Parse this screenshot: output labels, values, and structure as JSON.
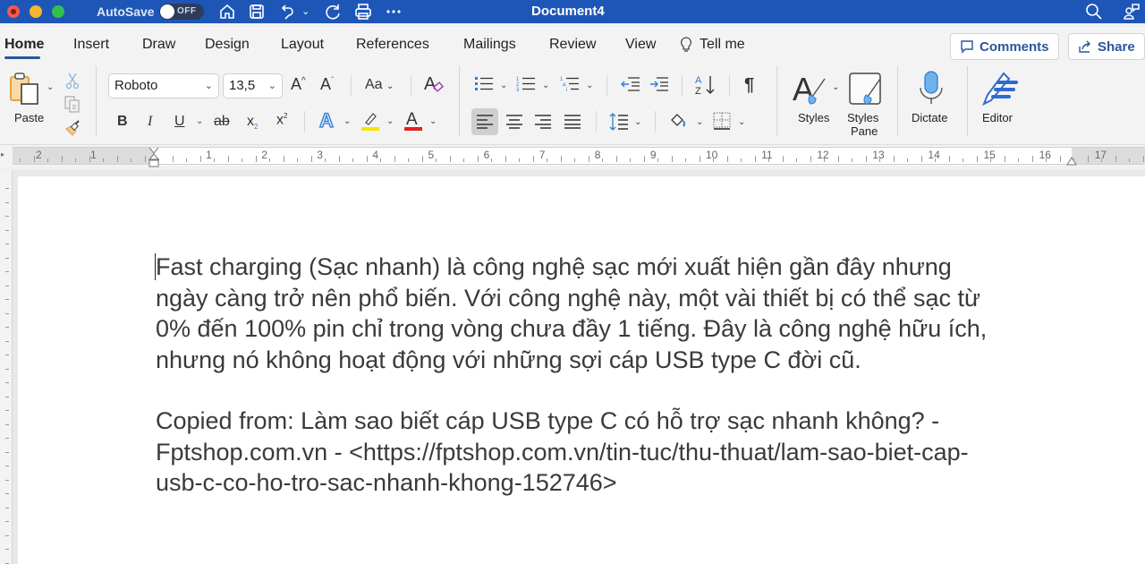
{
  "window": {
    "autosave_label": "AutoSave",
    "autosave_state": "OFF",
    "document_title": "Document4",
    "quick_access": [
      "home-icon",
      "save-icon",
      "undo-icon",
      "undo-dropdown",
      "redo-icon",
      "print-icon",
      "more-icon"
    ],
    "right_icons": [
      "search-icon",
      "account-icon"
    ]
  },
  "tabs": [
    {
      "label": "Home",
      "active": true
    },
    {
      "label": "Insert"
    },
    {
      "label": "Draw"
    },
    {
      "label": "Design"
    },
    {
      "label": "Layout"
    },
    {
      "label": "References"
    },
    {
      "label": "Mailings"
    },
    {
      "label": "Review"
    },
    {
      "label": "View"
    },
    {
      "label": "Tell me"
    }
  ],
  "top_buttons": {
    "comments": "Comments",
    "share": "Share"
  },
  "ribbon": {
    "paste_label": "Paste",
    "font_name": "Roboto",
    "font_size": "13,5",
    "change_case_label": "Aa",
    "styles_label": "Styles",
    "styles_pane_label_1": "Styles",
    "styles_pane_label_2": "Pane",
    "dictate_label": "Dictate",
    "editor_label": "Editor",
    "bold": "B",
    "italic": "I",
    "underline": "U",
    "strike": "ab",
    "subscript": "x",
    "superscript": "x",
    "highlight_color": "#f5e600",
    "font_color": "#e02020",
    "paragraph_mark": "¶"
  },
  "ruler": {
    "left_numbers": [
      "2",
      "1"
    ],
    "right_numbers": [
      "1",
      "2",
      "3",
      "4",
      "5",
      "6",
      "7",
      "8",
      "9",
      "10",
      "11",
      "12",
      "13",
      "14",
      "15",
      "16",
      "17"
    ]
  },
  "document": {
    "paragraph1_lines": [
      "Fast charging (Sạc nhanh) là công nghệ sạc mới xuất hiện gần đây nhưng",
      "ngày càng trở nên phổ biến. Với công nghệ này, một vài thiết bị có thể sạc từ",
      "0% đến 100% pin chỉ trong vòng chưa đầy 1 tiếng. Đây là công nghệ hữu ích,",
      "nhưng nó không hoạt động với những sợi cáp USB type C đời cũ."
    ],
    "paragraph2_lines": [
      "Copied from: Làm sao biết cáp USB type C có hỗ trợ sạc nhanh không? -",
      "Fptshop.com.vn - <https://fptshop.com.vn/tin-tuc/thu-thuat/lam-sao-biet-cap-",
      "usb-c-co-ho-tro-sac-nhanh-khong-152746>"
    ]
  }
}
